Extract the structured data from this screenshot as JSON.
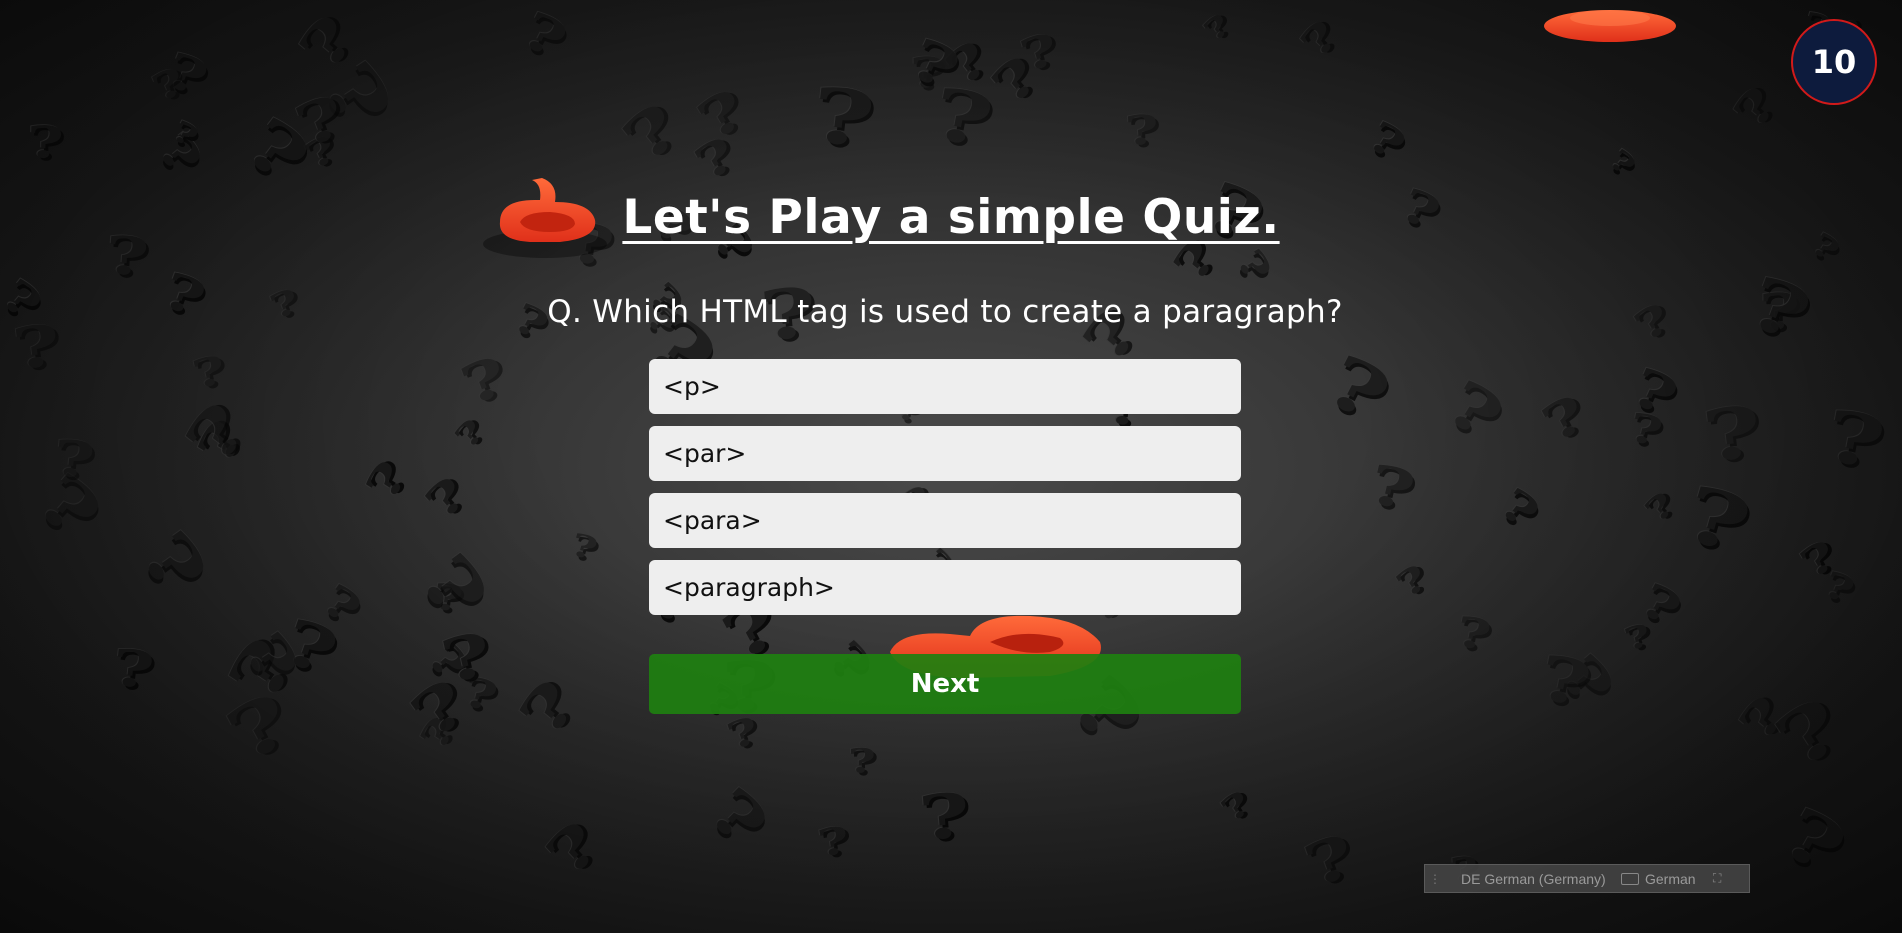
{
  "timer": {
    "value": "10"
  },
  "quiz": {
    "title": "Let's Play a simple Quiz.",
    "question": "Q. Which HTML tag is used to create a paragraph?",
    "options": [
      "<p>",
      "<par>",
      "<para>",
      "<paragraph>"
    ],
    "next_label": "Next"
  },
  "language_bar": {
    "input_language": "DE German (Germany)",
    "keyboard_layout": "German"
  },
  "colors": {
    "timer_bg": "#0d1b3d",
    "timer_border": "#d11a1a",
    "option_bg": "#eeeeee",
    "next_bg": "#1e8010",
    "accent_qmark": "#ff4a1c"
  },
  "icons": [
    "keyboard-icon",
    "restore-icon",
    "grip-icon"
  ]
}
